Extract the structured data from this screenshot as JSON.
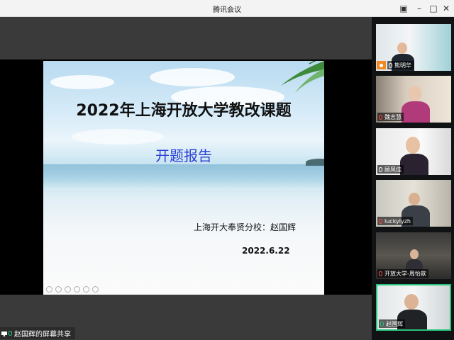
{
  "window": {
    "title": "腾讯会议"
  },
  "slide": {
    "title": "2022年上海开放大学教改课题",
    "subtitle": "开题报告",
    "author": "上海开大奉贤分校：赵国辉",
    "date": "2022.6.22"
  },
  "share_badge": {
    "label": "赵国辉的屏幕共享"
  },
  "participants": [
    {
      "name": "熊明华",
      "host": true
    },
    {
      "name": "魏志慧"
    },
    {
      "name": "顾凤佳"
    },
    {
      "name": "luckylyzh"
    },
    {
      "name": "开放大学-周怡歆"
    },
    {
      "name": "赵国辉",
      "active": true
    }
  ],
  "colors": {
    "accent_green": "#27c27b",
    "host_orange": "#f08a24",
    "subtitle_blue": "#2b3fd6"
  }
}
